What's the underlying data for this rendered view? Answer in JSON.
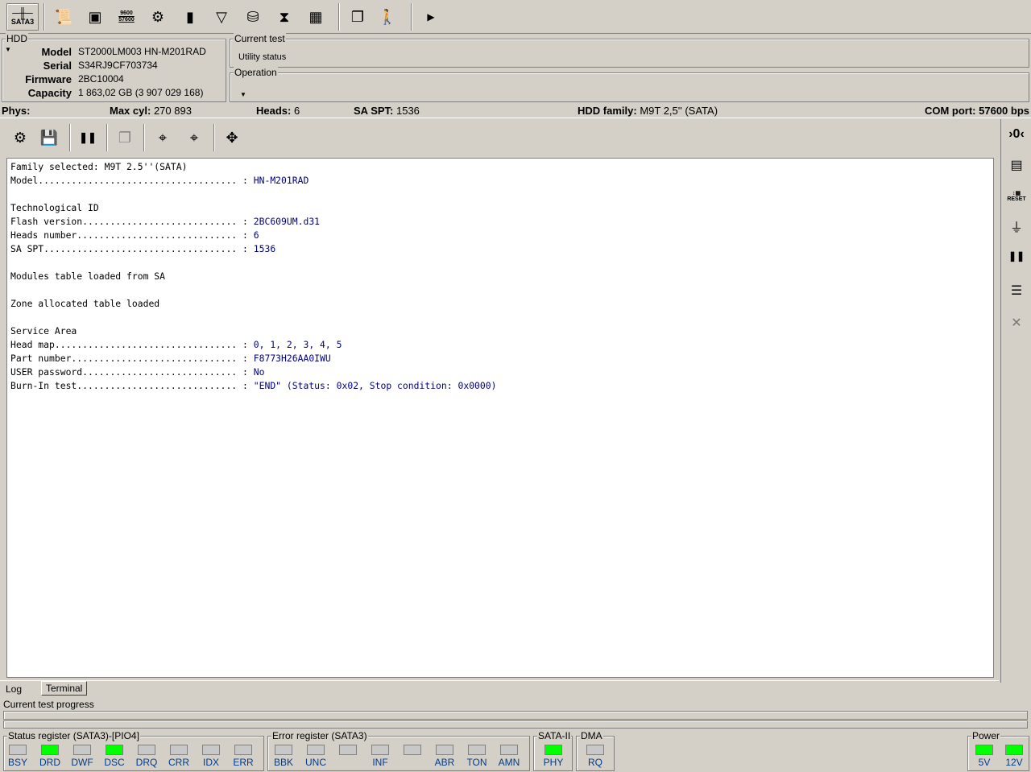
{
  "toolbar": {
    "interface_label": "SATA3",
    "baud_label_top": "9600",
    "baud_label_bottom": "57600"
  },
  "hdd": {
    "group_label": "HDD",
    "model_label": "Model",
    "model": "ST2000LM003 HN-M201RAD",
    "serial_label": "Serial",
    "serial": "S34RJ9CF703734",
    "firmware_label": "Firmware",
    "firmware": "2BC10004",
    "capacity_label": "Capacity",
    "capacity": "1 863,02 GB (3 907 029 168)"
  },
  "current_test": {
    "group_label": "Current test",
    "value": "Utility status"
  },
  "operation": {
    "group_label": "Operation"
  },
  "phys": {
    "label": "Phys:",
    "max_cyl_label": "Max cyl:",
    "max_cyl": "270 893",
    "heads_label": "Heads:",
    "heads": "6",
    "sa_spt_label": "SA SPT:",
    "sa_spt": "1536",
    "family_label": "HDD family:",
    "family": "M9T 2,5'' (SATA)",
    "com_label": "COM port:",
    "com": "57600 bps"
  },
  "log": {
    "lines": [
      {
        "t": "Family selected: M9T 2.5''(SATA)",
        "v": ""
      },
      {
        "t": "Model.................................... : ",
        "v": "HN-M201RAD"
      },
      {
        "t": "",
        "v": ""
      },
      {
        "t": "Technological ID",
        "v": ""
      },
      {
        "t": "Flash version............................ : ",
        "v": "2BC609UM.d31"
      },
      {
        "t": "Heads number............................. : ",
        "v": "6"
      },
      {
        "t": "SA SPT................................... : ",
        "v": "1536"
      },
      {
        "t": "",
        "v": ""
      },
      {
        "t": "Modules table loaded from SA",
        "v": ""
      },
      {
        "t": "",
        "v": ""
      },
      {
        "t": "Zone allocated table loaded",
        "v": ""
      },
      {
        "t": "",
        "v": ""
      },
      {
        "t": "Service Area",
        "v": ""
      },
      {
        "t": "Head map................................. : ",
        "v": "0, 1, 2, 3, 4, 5"
      },
      {
        "t": "Part number.............................. : ",
        "v": "F8773H26AA0IWU"
      },
      {
        "t": "USER password............................ : ",
        "v": "No"
      },
      {
        "t": "Burn-In test............................. : ",
        "v": "\"END\" (Status: 0x02, Stop condition: 0x0000)"
      }
    ]
  },
  "right_toolbar": {
    "reset_label": "RESET"
  },
  "tabs": {
    "log": "Log",
    "terminal": "Terminal"
  },
  "progress": {
    "label": "Current test progress",
    "value": 0
  },
  "status_register": {
    "label": "Status register (SATA3)-[PIO4]",
    "leds": [
      {
        "n": "BSY",
        "on": false
      },
      {
        "n": "DRD",
        "on": true
      },
      {
        "n": "DWF",
        "on": false
      },
      {
        "n": "DSC",
        "on": true
      },
      {
        "n": "DRQ",
        "on": false
      },
      {
        "n": "CRR",
        "on": false
      },
      {
        "n": "IDX",
        "on": false
      },
      {
        "n": "ERR",
        "on": false
      }
    ]
  },
  "error_register": {
    "label": "Error register (SATA3)",
    "leds": [
      {
        "n": "BBK",
        "on": false
      },
      {
        "n": "UNC",
        "on": false
      },
      {
        "n": "",
        "on": false
      },
      {
        "n": "INF",
        "on": false
      },
      {
        "n": "",
        "on": false
      },
      {
        "n": "ABR",
        "on": false
      },
      {
        "n": "TON",
        "on": false
      },
      {
        "n": "AMN",
        "on": false
      }
    ]
  },
  "sata2": {
    "label": "SATA-II",
    "leds": [
      {
        "n": "PHY",
        "on": true
      }
    ]
  },
  "dma": {
    "label": "DMA",
    "leds": [
      {
        "n": "RQ",
        "on": false
      }
    ]
  },
  "power": {
    "label": "Power",
    "leds": [
      {
        "n": "5V",
        "on": true
      },
      {
        "n": "12V",
        "on": true
      }
    ]
  },
  "colors": {
    "led_on": "#00ff00",
    "led_off": "#c8c8c8",
    "led_label": "#003c8c",
    "log_value": "#000080"
  }
}
